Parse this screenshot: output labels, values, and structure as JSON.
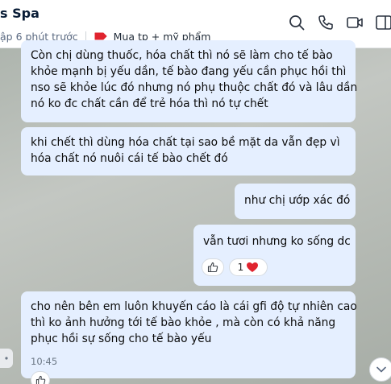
{
  "header": {
    "title": "s Spa",
    "status": "ập 6 phút trước",
    "tag_label": "Mua tp + mỹ phẩm",
    "tag_color": "#e0232e",
    "icons": [
      "search-icon",
      "phone-icon",
      "video-call-icon",
      "sidebar-toggle-icon"
    ]
  },
  "messages": [
    {
      "id": "msg1",
      "side": "left",
      "lines": [
        "Còn chị dùng thuốc, hóa chất thì nó sẽ làm cho tế bào",
        "khỏe mạnh bị yếu dần, tế bào đang yếu cần phục hồi thì",
        "nso sẽ khỏe lúc đó nhưng nó phụ thuộc chất đó và lâu dần",
        "nó ko đc chất cần để trẻ hóa thì nó tự chết"
      ]
    },
    {
      "id": "msg2",
      "side": "left",
      "lines": [
        "khi chết thì dùng hóa chất tại sao bề mặt da vẫn đẹp vì",
        "hóa chất nó nuôi cái tế bào chết đó"
      ]
    },
    {
      "id": "msg3",
      "side": "right",
      "lines": [
        "như chị ướp xác đó"
      ]
    },
    {
      "id": "msg4",
      "side": "right",
      "lines": [
        "vẫn tươi nhưng ko sống dc"
      ],
      "reaction_count": "1",
      "reaction_emoji": "❤️"
    },
    {
      "id": "msg5",
      "side": "left",
      "lines": [
        "cho nên bên em luôn khuyến cáo là cái gfi độ tự nhiên cao",
        "thì ko ảnh hưởng tới tế bào khỏe , mà còn có khả năng",
        "phục hồi sự sống cho tế bào yếu"
      ],
      "time": "10:45"
    }
  ],
  "colors": {
    "bubble": "#e5efff",
    "accent": "#0068ff"
  }
}
